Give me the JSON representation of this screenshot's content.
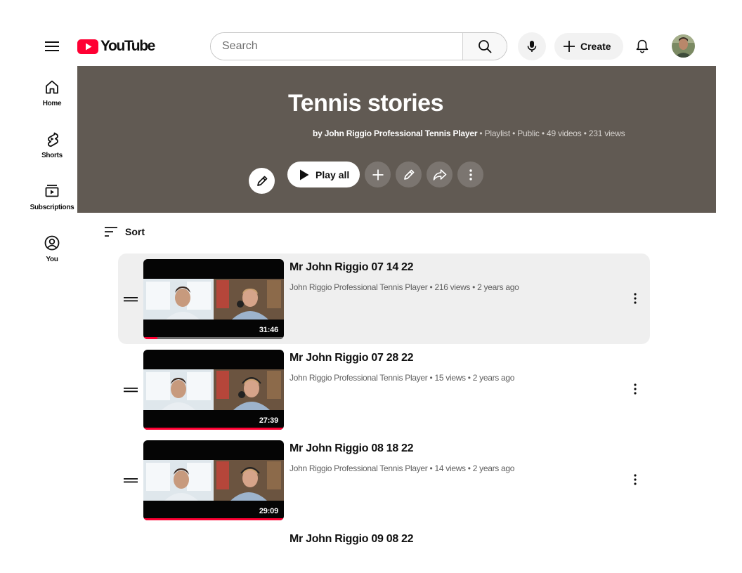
{
  "header": {
    "brand": "YouTube",
    "search_placeholder": "Search",
    "create_label": "Create"
  },
  "nav": {
    "items": [
      {
        "label": "Home",
        "icon": "home-icon"
      },
      {
        "label": "Shorts",
        "icon": "shorts-icon"
      },
      {
        "label": "Subscriptions",
        "icon": "subscriptions-icon"
      },
      {
        "label": "You",
        "icon": "you-icon"
      }
    ]
  },
  "playlist": {
    "title": "Tennis stories",
    "owner": "by John Riggio Professional Tennis Player",
    "details": " • Playlist • Public • 49 videos • 231 views",
    "play_all_label": "Play all",
    "banner_color": "#615a53"
  },
  "sort": {
    "label": "Sort"
  },
  "videos": [
    {
      "title": "Mr John Riggio 07 14 22",
      "channel": "John Riggio Professional Tennis Player",
      "stats": " • 216 views • 2 years ago",
      "duration": "31:46",
      "progress": 0.1,
      "highlighted": true
    },
    {
      "title": "Mr John Riggio 07 28 22",
      "channel": "John Riggio Professional Tennis Player",
      "stats": " • 15 views • 2 years ago",
      "duration": "27:39",
      "progress": 1.0
    },
    {
      "title": "Mr John Riggio 08 18 22",
      "channel": "John Riggio Professional Tennis Player",
      "stats": " • 14 views • 2 years ago",
      "duration": "29:09",
      "progress": 1.0
    },
    {
      "title": "Mr John Riggio 09 08 22"
    }
  ],
  "colors": {
    "brand_red": "#ff0033",
    "progress_red": "#ff0033",
    "row_highlight": "#efefef"
  }
}
